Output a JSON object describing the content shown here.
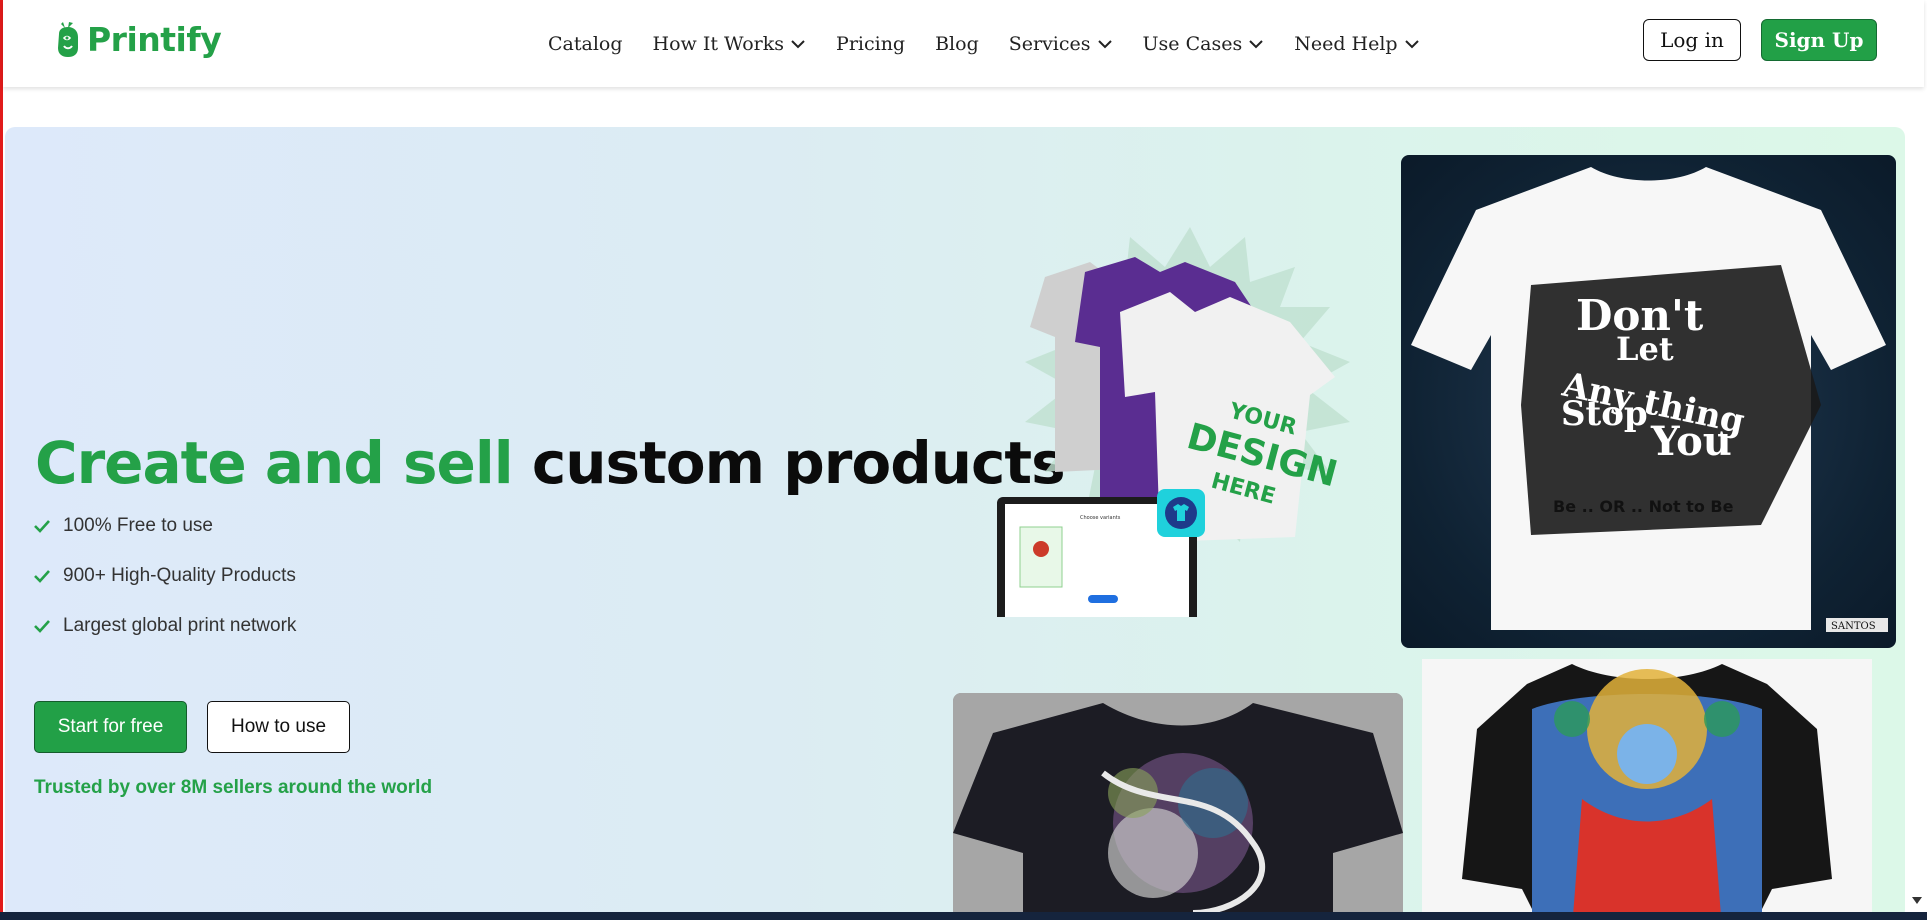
{
  "brand": {
    "name": "Printify",
    "color": "#24a148"
  },
  "nav": {
    "items": [
      {
        "label": "Catalog",
        "dropdown": false
      },
      {
        "label": "How It Works",
        "dropdown": true
      },
      {
        "label": "Pricing",
        "dropdown": false
      },
      {
        "label": "Blog",
        "dropdown": false
      },
      {
        "label": "Services",
        "dropdown": true
      },
      {
        "label": "Use Cases",
        "dropdown": true
      },
      {
        "label": "Need Help",
        "dropdown": true
      }
    ]
  },
  "auth": {
    "login_label": "Log in",
    "signup_label": "Sign Up"
  },
  "hero": {
    "headline_green": "Create and sell",
    "headline_dark": "custom products",
    "features": [
      "100% Free to use",
      "900+ High-Quality Products",
      "Largest global print network"
    ],
    "start_label": "Start for free",
    "howto_label": "How to use",
    "trusted": "Trusted by over 8M sellers around the world"
  },
  "images": {
    "mockup_tshirt_text_1": "YOUR",
    "mockup_tshirt_text_2": "DESIGN",
    "mockup_tshirt_text_3": "HERE",
    "mockup_laptop_title": "Choose variants",
    "tshirt_slogan_1": "Don't",
    "tshirt_slogan_2": "Let",
    "tshirt_slogan_3": "Any thing",
    "tshirt_slogan_4": "Stop",
    "tshirt_slogan_5": "You",
    "tshirt_tagline": "Be .. OR .. Not to Be",
    "tshirt_brand": "SANTOS"
  }
}
